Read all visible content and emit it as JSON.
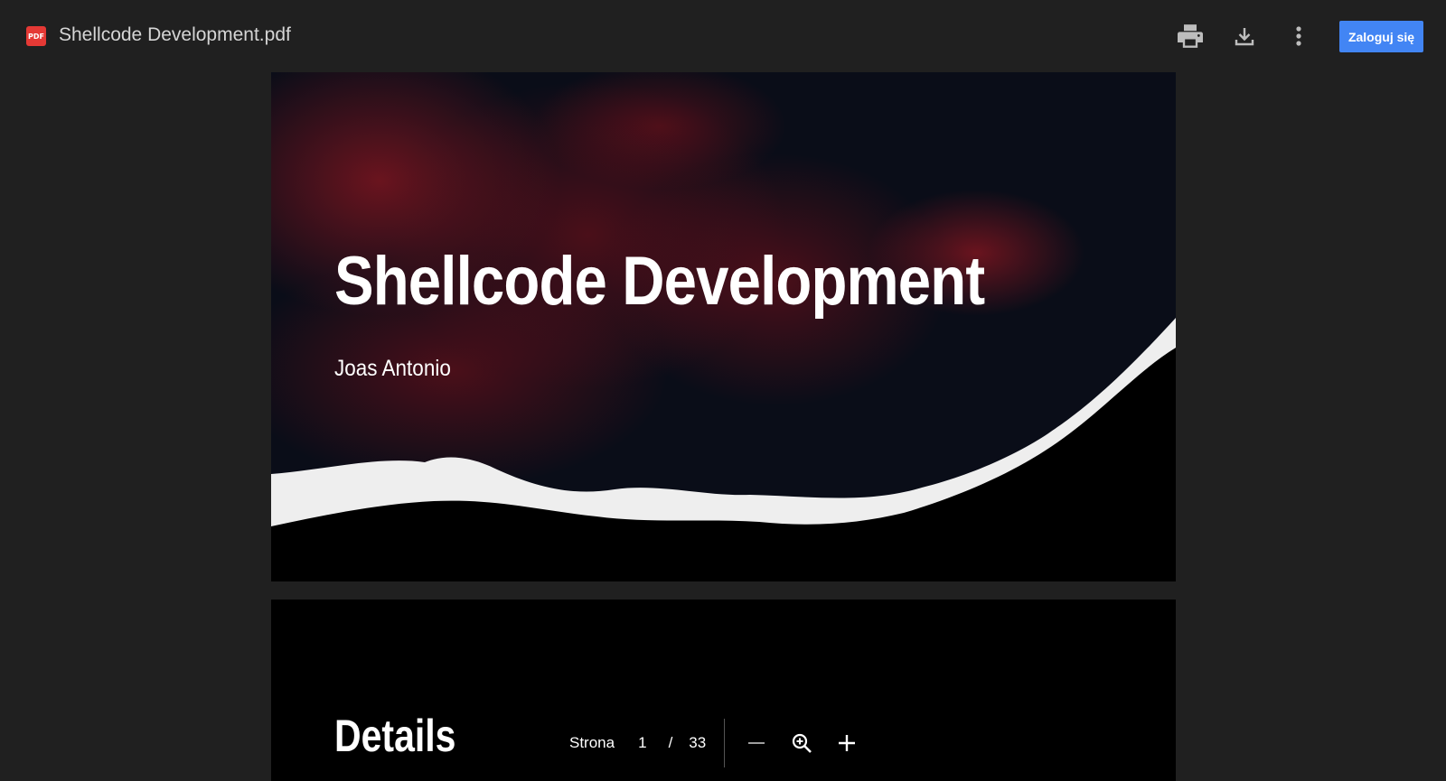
{
  "toolbar": {
    "file_badge": "PDF",
    "file_name": "Shellcode Development.pdf",
    "print_icon": "print-icon",
    "download_icon": "download-icon",
    "more_icon": "more-vert-icon",
    "signin_label": "Zaloguj się",
    "signin_color": "#4285f4"
  },
  "document": {
    "page1": {
      "title": "Shellcode Development",
      "author": "Joas Antonio"
    },
    "page2": {
      "title": "Details"
    }
  },
  "pager": {
    "label": "Strona",
    "current_page": "1",
    "separator": "/",
    "total_pages": "33",
    "zoom_out_icon": "minus-icon",
    "zoom_icon": "zoom-in-icon",
    "zoom_in_icon": "plus-icon"
  }
}
